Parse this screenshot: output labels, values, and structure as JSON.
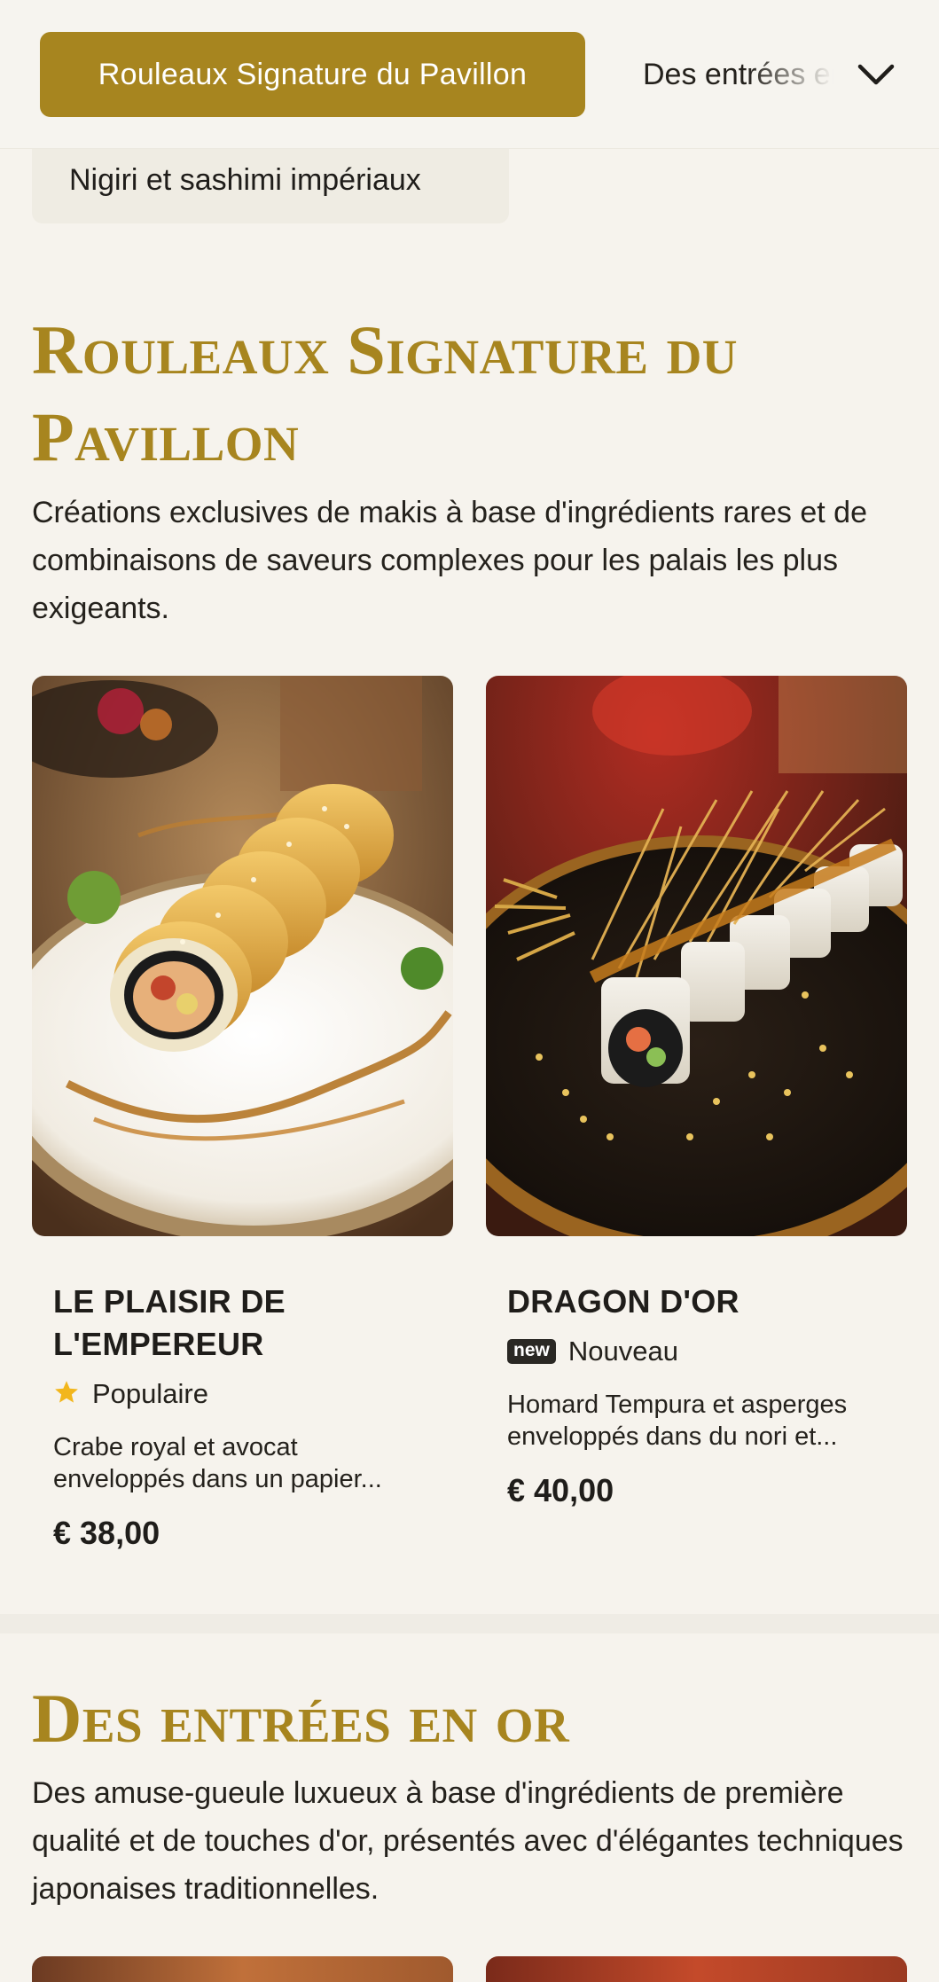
{
  "nav": {
    "active_category": "Rouleaux Signature du Pavillon",
    "next_category": "Des entrées en or",
    "second_row_category": "Nigiri et sashimi impériaux",
    "chevron_icon": "chevron-down-icon"
  },
  "sections": [
    {
      "title": "Rouleaux Signature du Pavillon",
      "description": "Créations exclusives de makis à base d'ingrédients rares et de combinaisons de saveurs complexes pour les palais les plus exigeants."
    },
    {
      "title": "Des entrées en or",
      "description": "Des amuse-gueule luxueux à base d'ingrédients de première qualité et de touches d'or, présentés avec d'élégantes techniques japonaises traditionnelles."
    }
  ],
  "products": [
    {
      "name": "LE PLAISIR DE L'EMPEREUR",
      "badge_icon": "star-icon",
      "badge_label": "Populaire",
      "description": "Crabe royal et avocat enveloppés dans un papier...",
      "price": "€ 38,00"
    },
    {
      "name": "DRAGON D'OR",
      "badge_tag": "new",
      "badge_label": "Nouveau",
      "description": "Homard Tempura et asperges enveloppés dans du nori et...",
      "price": "€ 40,00"
    }
  ],
  "colors": {
    "accent_gold": "#a7851f",
    "background": "#f6f3ed",
    "star": "#f2b61c"
  }
}
